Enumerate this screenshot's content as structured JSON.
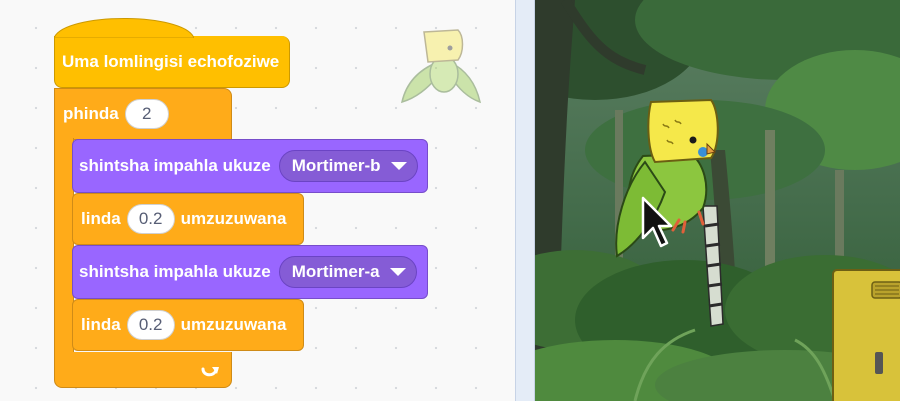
{
  "script": {
    "hat_label": "Uma lomlingisi echofoziwe",
    "repeat": {
      "label": "phinda",
      "count": "2"
    },
    "switch1": {
      "label": "shintsha impahla ukuze",
      "costume": "Mortimer-b"
    },
    "wait1": {
      "label": "linda",
      "seconds": "0.2",
      "unit": "umzuzuwana"
    },
    "switch2": {
      "label": "shintsha impahla ukuze",
      "costume": "Mortimer-a"
    },
    "wait2": {
      "label": "linda",
      "seconds": "0.2",
      "unit": "umzuzuwana"
    },
    "loop_arrow_icon": "loop-arrow-icon"
  },
  "colors": {
    "events": "#ffbf00",
    "control": "#ffab19",
    "looks": "#9966ff",
    "looks_dropdown": "#855cd6"
  },
  "stage": {
    "sprite": "Mortimer",
    "backdrop": "forest",
    "cursor": "arrow-cursor-icon"
  }
}
